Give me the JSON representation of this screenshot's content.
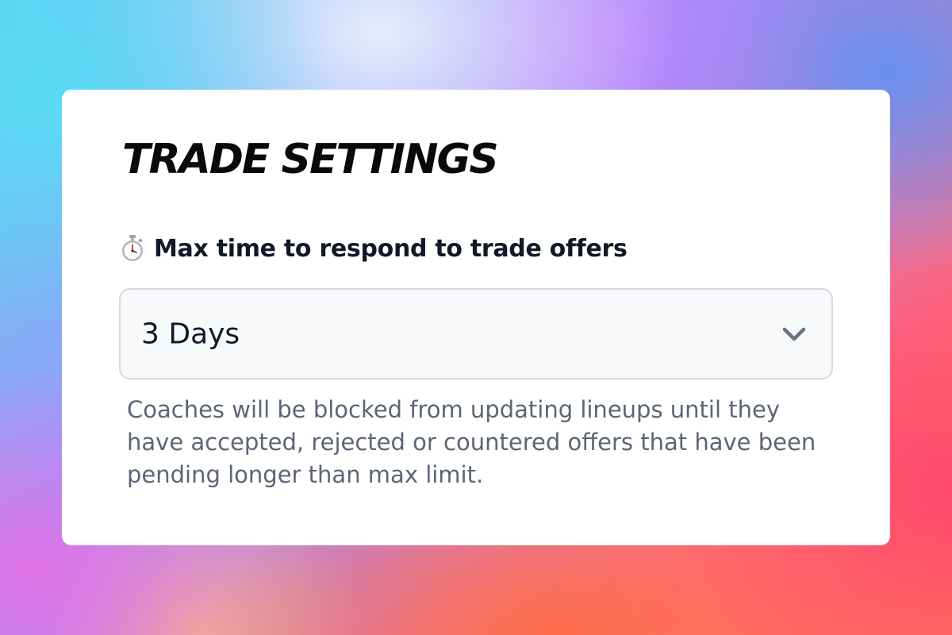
{
  "background": {
    "colors": [
      "#5fd0f2",
      "#c084fc",
      "#6391f0",
      "#ff466e",
      "#ff6e46",
      "#e86ee6"
    ]
  },
  "card": {
    "title": "TRADE SETTINGS",
    "field": {
      "icon": "stopwatch-icon",
      "label": "Max time to respond to trade offers",
      "selected_value": "3 Days",
      "dropdown_icon": "chevron-down-icon",
      "help_text": "Coaches will be blocked from updating lineups until they have accepted, rejected or countered offers that have been pending longer than max limit."
    }
  }
}
